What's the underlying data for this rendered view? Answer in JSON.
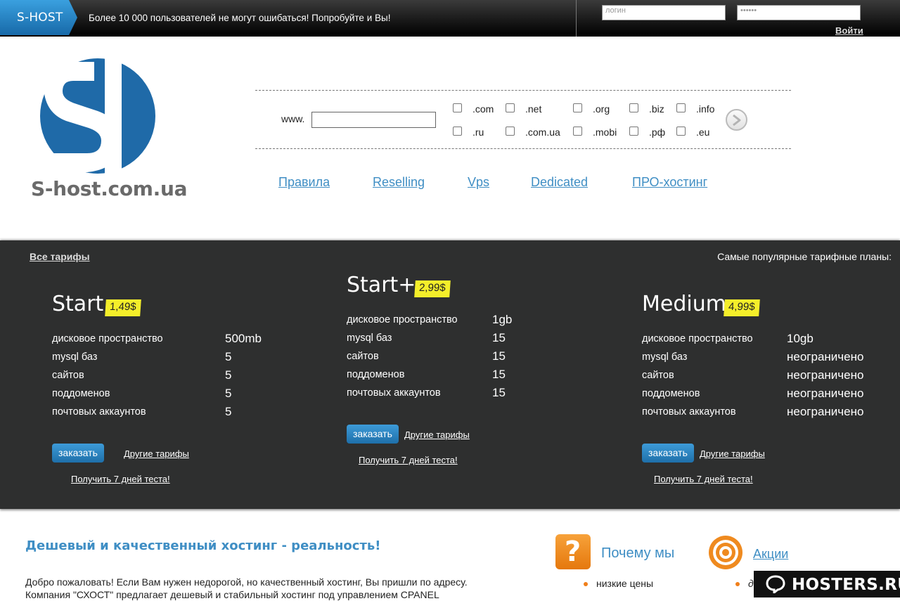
{
  "topbar": {
    "brand": "S-HOST",
    "slogan": "Более 10 000 пользователей не могут ошибаться! Попробуйте и Вы!",
    "login_placeholder": "логин",
    "password_mask": "••••••",
    "login_button": "Войти"
  },
  "header": {
    "logo_text": "S-host.com.ua",
    "www_label": "www.",
    "tlds": [
      ".com",
      ".net",
      ".org",
      ".biz",
      ".info",
      ".ru",
      ".com.ua",
      ".mobi",
      ".рф",
      ".eu"
    ],
    "nav": [
      "Правила",
      "Reselling",
      "Vps",
      "Dedicated",
      "ПРО-хостинг"
    ]
  },
  "tariffs": {
    "all_link": "Все тарифы",
    "popular_label": "Самые популярные тарифные планы:",
    "plans": [
      {
        "name": "Start",
        "price": "1,49$",
        "specs": [
          {
            "label": "дисковое пространство",
            "value": "500mb"
          },
          {
            "label": "mysql баз",
            "value": "5"
          },
          {
            "label": "сайтов",
            "value": "5"
          },
          {
            "label": "поддоменов",
            "value": "5"
          },
          {
            "label": "почтовых аккаунтов",
            "value": "5"
          }
        ],
        "order": "заказать",
        "other": "Другие тарифы",
        "test": "Получить 7 дней теста!"
      },
      {
        "name": "Start+",
        "price": "2,99$",
        "specs": [
          {
            "label": "дисковое пространство",
            "value": "1gb"
          },
          {
            "label": "mysql баз",
            "value": "15"
          },
          {
            "label": "сайтов",
            "value": "15"
          },
          {
            "label": "поддоменов",
            "value": "15"
          },
          {
            "label": "почтовых аккаунтов",
            "value": "15"
          }
        ],
        "order": "заказать",
        "other": "Другие тарифы",
        "test": "Получить 7 дней теста!"
      },
      {
        "name": "Medium",
        "price": "4,99$",
        "specs": [
          {
            "label": "дисковое пространство",
            "value": "10gb"
          },
          {
            "label": "mysql баз",
            "value": "неограничено"
          },
          {
            "label": "сайтов",
            "value": "неограничено"
          },
          {
            "label": "поддоменов",
            "value": "неограничено"
          },
          {
            "label": "почтовых аккаунтов",
            "value": "неограничено"
          }
        ],
        "order": "заказать",
        "other": "Другие тарифы",
        "test": "Получить 7 дней теста!"
      }
    ]
  },
  "about": {
    "title": "Дешевый и качественный хостинг - реальность!",
    "text": "Добро пожаловать! Если Вам нужен недорогой, но качественный хостинг, Вы пришли по адресу. Компания \"СХОСТ\" предлагает дешевый и стабильный хостинг под управлением CPANEL"
  },
  "why": {
    "icon_glyph": "?",
    "title": "Почему мы",
    "items": [
      "низкие цены"
    ]
  },
  "promo": {
    "title": "Акции",
    "items": [
      "д"
    ]
  },
  "watermark": "HOSTERS.RU",
  "colors": {
    "accent_blue": "#3f8ec4",
    "logo_blue": "#1f6aa8",
    "dark_panel": "#2e2f2f",
    "price_yellow": "#f4ee2a",
    "orange": "#f07f1a"
  }
}
